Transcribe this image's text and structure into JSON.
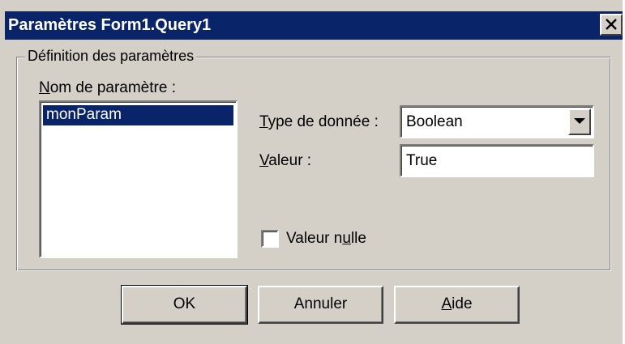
{
  "window": {
    "title": "Paramètres Form1.Query1"
  },
  "group": {
    "legend": "Définition des paramètres"
  },
  "param_list": {
    "label_mnemonic": "N",
    "label_rest": "om de paramètre :",
    "items": [
      "monParam"
    ],
    "selected_index": 0
  },
  "data_type": {
    "label_mnemonic": "T",
    "label_rest": "ype de donnée :",
    "value": "Boolean"
  },
  "value_field": {
    "label_mnemonic": "V",
    "label_rest": "aleur :",
    "value": "True"
  },
  "null_checkbox": {
    "label_before": "Valeur n",
    "label_mnemonic": "u",
    "label_after": "lle",
    "checked": false
  },
  "buttons": {
    "ok": "OK",
    "cancel": "Annuler",
    "help_mnemonic": "A",
    "help_rest": "ide"
  },
  "icons": {
    "close": "close-icon",
    "dropdown": "dropdown-arrow-icon"
  },
  "colors": {
    "titlebar": "#0a246a",
    "face": "#d4d0c8",
    "selection": "#0a246a"
  }
}
